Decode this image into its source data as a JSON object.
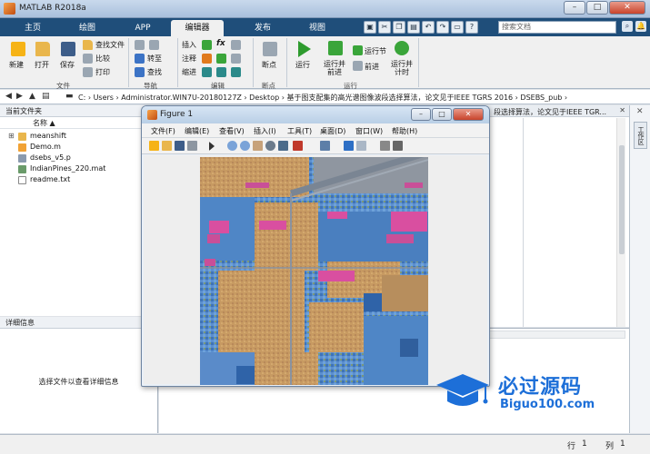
{
  "window": {
    "title": "MATLAB R2018a"
  },
  "tabs": [
    {
      "label": "主页",
      "active": false
    },
    {
      "label": "绘图",
      "active": false
    },
    {
      "label": "APP",
      "active": false
    },
    {
      "label": "编辑器",
      "active": true
    },
    {
      "label": "发布",
      "active": false
    },
    {
      "label": "视图",
      "active": false
    }
  ],
  "search": {
    "placeholder": "搜索文档"
  },
  "ribbon": {
    "file": {
      "new": "新建",
      "open": "打开",
      "save": "保存",
      "find_files": "查找文件",
      "compare": "比较",
      "print": "打印",
      "group": "文件"
    },
    "navigate": {
      "goto": "转至",
      "find": "查找",
      "group": "导航"
    },
    "edit": {
      "insert": "插入",
      "fx": "fx",
      "comment": "注释",
      "indent": "缩进",
      "group": "编辑"
    },
    "breakpoints": {
      "label": "断点",
      "group": "断点"
    },
    "run": {
      "run": "运行",
      "run_advance": "运行并\n前进",
      "run_section": "运行节",
      "advance": "前进",
      "run_time": "运行并\n计时",
      "group": "运行"
    }
  },
  "address": {
    "path": "C: › Users › Administrator.WIN7U-20180127Z › Desktop › 基于图支配集的高光谱图像波段选择算法，论文见于IEEE TGRS 2016 › DSEBS_pub ›"
  },
  "current_folder": {
    "header": "当前文件夹",
    "column": "名称 ▲",
    "files": [
      {
        "name": "meanshift",
        "type": "folder"
      },
      {
        "name": "Demo.m",
        "type": "m"
      },
      {
        "name": "dsebs_v5.p",
        "type": "p"
      },
      {
        "name": "IndianPines_220.mat",
        "type": "mat"
      },
      {
        "name": "readme.txt",
        "type": "txt"
      }
    ]
  },
  "details": {
    "header": "详细信息",
    "message": "选择文件以查看详细信息"
  },
  "editor": {
    "tab_text": "段选择算法，论文见于IEEE TGR..."
  },
  "workspace_tab": "工作区",
  "status": {
    "row_label": "行",
    "row": "1",
    "col_label": "列",
    "col": "1"
  },
  "figure": {
    "title": "Figure 1",
    "menu": [
      "文件(F)",
      "编辑(E)",
      "查看(V)",
      "插入(I)",
      "工具(T)",
      "桌面(D)",
      "窗口(W)",
      "帮助(H)"
    ]
  },
  "watermark": {
    "cn": "必过源码",
    "en": "Biguo100.com"
  },
  "colors": {
    "tabbar": "#1f4e7a",
    "accent": "#1d6fd8",
    "soil": "#c79a62",
    "vegetation": "#4b86c4",
    "highlight": "#d94fa0"
  }
}
